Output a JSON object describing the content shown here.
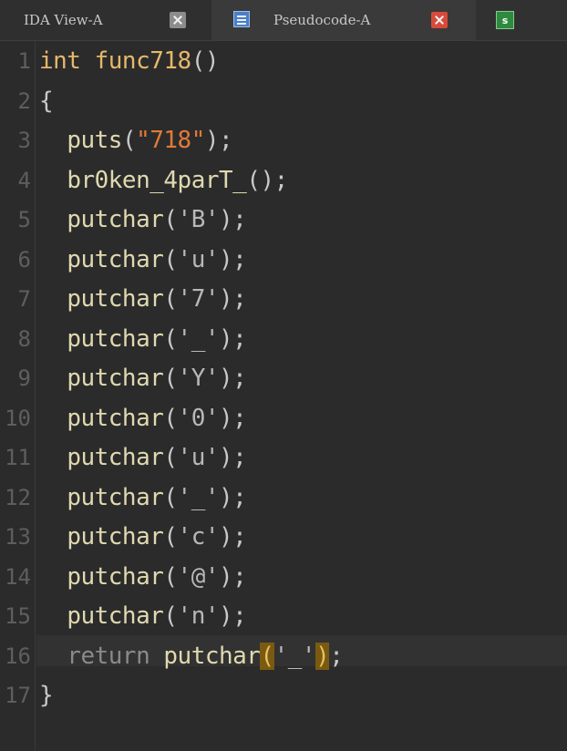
{
  "tabs": [
    {
      "label": "IDA View-A",
      "active": false
    },
    {
      "label": "Pseudocode-A",
      "active": true
    },
    {
      "label": "",
      "icon": "strings-window-icon",
      "icon_text": "s"
    }
  ],
  "colors": {
    "background": "#2b2b2b",
    "keyword": "#e6b86a",
    "identifier": "#e0d9b0",
    "string": "#e07a3a",
    "char_literal": "#b8b8b8",
    "line_number": "#5e5e5e",
    "highlight": "#7a5a10"
  },
  "code": {
    "line_numbers": [
      "1",
      "2",
      "3",
      "4",
      "5",
      "6",
      "7",
      "8",
      "9",
      "10",
      "11",
      "12",
      "13",
      "14",
      "15",
      "16",
      "17"
    ],
    "func_type": "int",
    "func_name": "func718",
    "open_paren": "(",
    "close_paren": ")",
    "open_brace": "{",
    "close_brace": "}",
    "puts_call": "puts",
    "puts_arg": "\"718\"",
    "call_suffix": ");",
    "broken_call": "br0ken_4parT_",
    "broken_suffix": "();",
    "putchar_name": "putchar",
    "putchar_args": [
      "'B'",
      "'u'",
      "'7'",
      "'_'",
      "'Y'",
      "'0'",
      "'u'",
      "'_'",
      "'c'",
      "'@'",
      "'n'"
    ],
    "return_keyword": "return",
    "return_call": "putchar",
    "return_arg": "'_'",
    "return_suffix": ";"
  }
}
